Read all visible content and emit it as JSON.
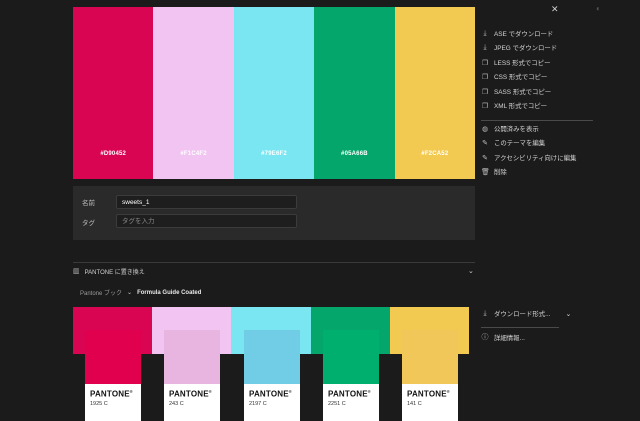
{
  "palette": {
    "swatches": [
      {
        "color": "#D90452",
        "hex": "#D90452"
      },
      {
        "color": "#F1C4F2",
        "hex": "#F1C4F2"
      },
      {
        "color": "#79E6F2",
        "hex": "#79E6F2"
      },
      {
        "color": "#05A66B",
        "hex": "#05A66B"
      },
      {
        "color": "#F2CA52",
        "hex": "#F2CA52"
      }
    ]
  },
  "form": {
    "name_label": "名前",
    "name_value": "sweets_1",
    "tag_label": "タグ",
    "tag_placeholder": "タグを入力"
  },
  "menu": {
    "close": "✕",
    "items": [
      {
        "label": "ASE でダウンロード",
        "icon": "download-icon"
      },
      {
        "label": "JPEG でダウンロード",
        "icon": "download-icon"
      },
      {
        "label": "LESS 形式でコピー",
        "icon": "copy-icon"
      },
      {
        "label": "CSS 形式でコピー",
        "icon": "copy-icon"
      },
      {
        "label": "SASS 形式でコピー",
        "icon": "copy-icon"
      },
      {
        "label": "XML 形式でコピー",
        "icon": "copy-icon"
      },
      {
        "label": "公開済みを表示",
        "icon": "globe-icon"
      },
      {
        "label": "このテーマを編集",
        "icon": "edit-icon"
      },
      {
        "label": "アクセシビリティ向けに編集",
        "icon": "edit-icon"
      },
      {
        "label": "削除",
        "icon": "trash-icon"
      }
    ]
  },
  "pantone": {
    "header": "PANTONE に置き換え",
    "book_label": "Pantone ブック",
    "book_value": "Formula Guide Coated",
    "download": "ダウンロード形式...",
    "info": "詳細情報...",
    "brand": "PANTONE",
    "bar_colors": [
      "#D90452",
      "#F1C4F2",
      "#79E6F2",
      "#05A66B",
      "#F2CA52"
    ],
    "chips": [
      {
        "code": "1925 C",
        "color": "#E0004D"
      },
      {
        "code": "243 C",
        "color": "#E8B5E0"
      },
      {
        "code": "2197 C",
        "color": "#71CDE6"
      },
      {
        "code": "2251 C",
        "color": "#00AF6D"
      },
      {
        "code": "141 C",
        "color": "#F0C758"
      }
    ]
  }
}
